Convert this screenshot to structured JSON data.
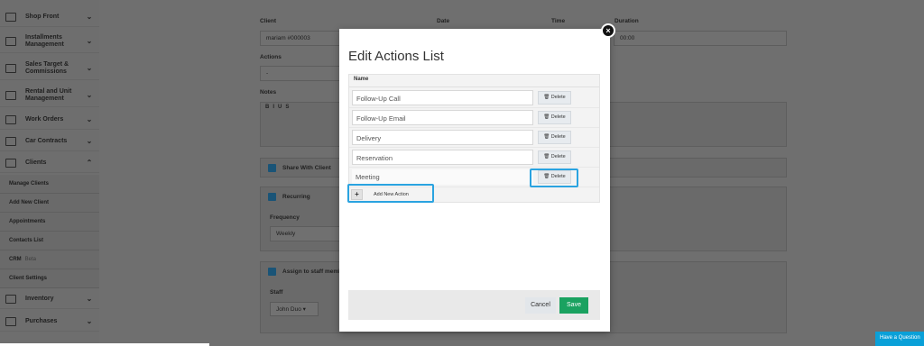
{
  "sidebar": {
    "items": [
      {
        "label": "Shop Front",
        "icon": "shop-icon",
        "chev": "⌄"
      },
      {
        "label": "Installments Management",
        "icon": "installments-icon",
        "chev": "⌄"
      },
      {
        "label": "Sales Target & Commissions",
        "icon": "target-icon",
        "chev": "⌄"
      },
      {
        "label": "Rental and Unit Management",
        "icon": "rental-icon",
        "chev": "⌄"
      },
      {
        "label": "Work Orders",
        "icon": "work-orders-icon",
        "chev": "⌄"
      },
      {
        "label": "Car Contracts",
        "icon": "contract-icon",
        "chev": "⌄"
      },
      {
        "label": "Clients",
        "icon": "clients-icon",
        "chev": "⌃"
      }
    ],
    "client_sub": [
      {
        "label": "Manage Clients"
      },
      {
        "label": "Add New Client"
      },
      {
        "label": "Appointments"
      },
      {
        "label": "Contacts List"
      },
      {
        "label": "CRM",
        "badge": "Beta"
      },
      {
        "label": "Client Settings"
      }
    ],
    "bottom_items": [
      {
        "label": "Inventory",
        "icon": "inventory-icon",
        "chev": "⌄"
      },
      {
        "label": "Purchases",
        "icon": "purchases-icon",
        "chev": "⌄"
      }
    ]
  },
  "background_form": {
    "client_label": "Client",
    "client_value": "mariam #000003",
    "date_label": "Date",
    "time_label": "Time",
    "duration_label": "Duration",
    "duration_value": "00:00",
    "actions_label": "Actions",
    "actions_value": "-",
    "notes_label": "Notes",
    "share_label": "Share With Client",
    "recurring_label": "Recurring",
    "frequency_label": "Frequency",
    "frequency_value": "Weekly",
    "assign_label": "Assign to staff memb",
    "staff_label": "Staff",
    "staff_value": "John Duo"
  },
  "modal": {
    "title": "Edit Actions List",
    "column_header": "Name",
    "delete_label": "Delete",
    "actions": [
      "Follow-Up Call",
      "Follow-Up Email",
      "Delivery",
      "Reservation",
      "Meeting"
    ],
    "add_label": "Add New Action",
    "cancel_label": "Cancel",
    "save_label": "Save",
    "close_glyph": "×"
  },
  "help": {
    "label": "Have a Question"
  },
  "colors": {
    "accent": "#2aa3e0",
    "save": "#1aa260",
    "help": "#0aa0d8"
  }
}
